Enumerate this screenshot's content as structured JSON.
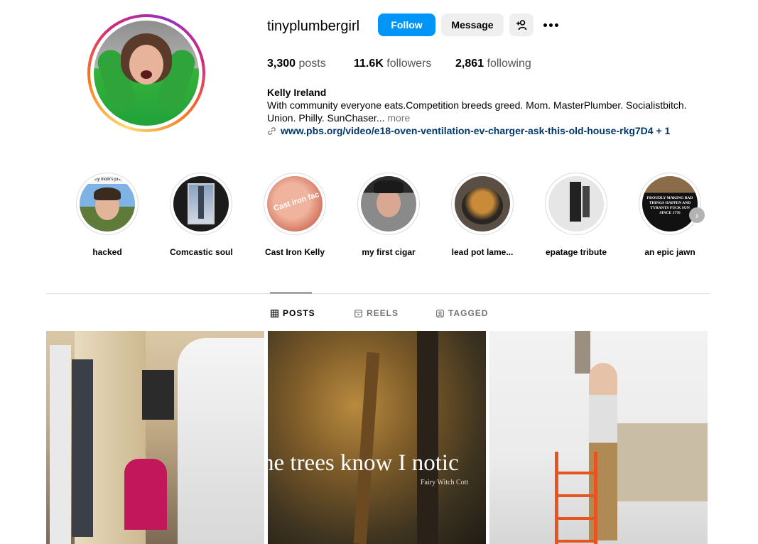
{
  "profile": {
    "username": "tinyplumbergirl",
    "follow_label": "Follow",
    "message_label": "Message",
    "stats": {
      "posts_count": "3,300",
      "posts_label": "posts",
      "followers_count": "11.6K",
      "followers_label": "followers",
      "following_count": "2,861",
      "following_label": "following"
    },
    "bio": {
      "name": "Kelly Ireland",
      "line1": "With community everyone eats.Competition breeds greed. Mom. MasterPlumber. Socialistbitch.",
      "line2": "Union. Philly. SunChaser...",
      "more": "more",
      "link": "www.pbs.org/video/e18-oven-ventilation-ev-charger-ask-this-old-house-rkg7D4 + 1"
    }
  },
  "highlights": [
    {
      "label": "hacked",
      "image_text": "de my mom's phone"
    },
    {
      "label": "Comcastic soul"
    },
    {
      "label": "Cast Iron Kelly",
      "image_text": "Cast iron fac"
    },
    {
      "label": "my first cigar"
    },
    {
      "label": "lead pot lame..."
    },
    {
      "label": "epatage tribute"
    },
    {
      "label": "an epic jawn",
      "image_text": "PROUDLY MAKING BAD THINGS HAPPEN AND TYRANTS FUCK SUN SINCE 1776"
    }
  ],
  "tabs": [
    {
      "label": "POSTS",
      "icon": "grid-icon",
      "active": true
    },
    {
      "label": "REELS",
      "icon": "reels-icon",
      "active": false
    },
    {
      "label": "TAGGED",
      "icon": "tagged-icon",
      "active": false
    }
  ],
  "posts": [
    {
      "caption": ""
    },
    {
      "caption": "he trees know I notic",
      "subcaption": "Fairy Witch Cott"
    },
    {
      "caption": ""
    }
  ],
  "colors": {
    "follow_button": "#0095f6",
    "secondary_button": "#efefef",
    "link": "#00376b",
    "muted_text": "#737373"
  }
}
